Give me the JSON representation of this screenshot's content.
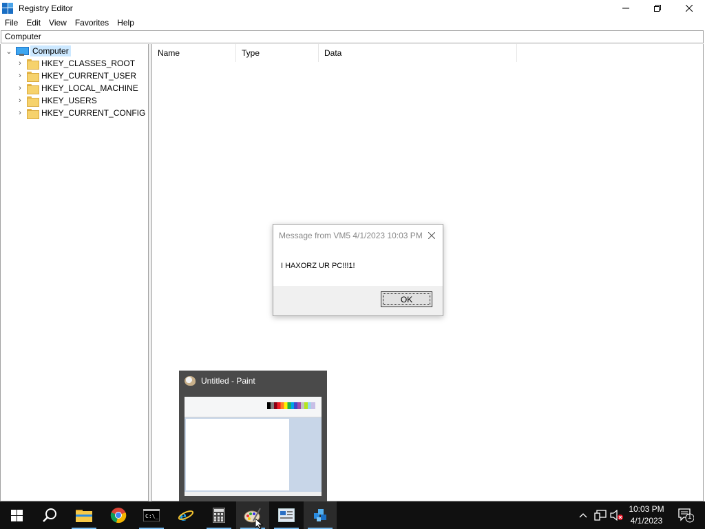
{
  "window": {
    "title": "Registry Editor",
    "controls": {
      "minimize": "—",
      "restore": "❐",
      "close": "✕"
    }
  },
  "menu": [
    "File",
    "Edit",
    "View",
    "Favorites",
    "Help"
  ],
  "address": "Computer",
  "tree": {
    "root": "Computer",
    "keys": [
      "HKEY_CLASSES_ROOT",
      "HKEY_CURRENT_USER",
      "HKEY_LOCAL_MACHINE",
      "HKEY_USERS",
      "HKEY_CURRENT_CONFIG"
    ]
  },
  "list": {
    "columns": [
      "Name",
      "Type",
      "Data"
    ]
  },
  "dialog": {
    "title": "Message from VM5 4/1/2023 10:03 PM",
    "message": "I HAXORZ UR PC!!!1!",
    "ok": "OK"
  },
  "preview": {
    "title": "Untitled - Paint"
  },
  "taskbar": {
    "apps": [
      "start-icon",
      "search-icon",
      "file-explorer-icon",
      "chrome-icon",
      "cmd-icon",
      "internet-explorer-icon",
      "calculator-icon",
      "paint-icon",
      "control-panel-icon",
      "registry-editor-icon"
    ],
    "clock": {
      "time": "10:03 PM",
      "date": "4/1/2023"
    },
    "notifications": "1"
  }
}
